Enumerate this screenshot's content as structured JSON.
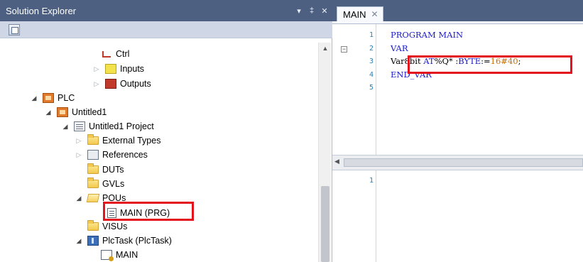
{
  "solution_explorer": {
    "title": "Solution Explorer",
    "title_buttons": [
      "▾",
      "‡",
      "✕"
    ],
    "tree": [
      {
        "label": "Ctrl",
        "icon": "ctrl-icon",
        "expander": ""
      },
      {
        "label": "Inputs",
        "icon": "inputs-icon",
        "expander": "▷"
      },
      {
        "label": "Outputs",
        "icon": "outputs-icon",
        "expander": "▷"
      },
      {
        "label": "PLC",
        "icon": "plc-icon",
        "expander": "◢"
      },
      {
        "label": "Untitled1",
        "icon": "plc-project-icon",
        "expander": "◢"
      },
      {
        "label": "Untitled1 Project",
        "icon": "project-icon",
        "expander": "◢"
      },
      {
        "label": "External Types",
        "icon": "folder-icon",
        "expander": "▷"
      },
      {
        "label": "References",
        "icon": "references-icon",
        "expander": "▷"
      },
      {
        "label": "DUTs",
        "icon": "folder-icon",
        "expander": ""
      },
      {
        "label": "GVLs",
        "icon": "folder-icon",
        "expander": ""
      },
      {
        "label": "POUs",
        "icon": "folder-open-icon",
        "expander": "◢"
      },
      {
        "label": "MAIN (PRG)",
        "icon": "program-icon",
        "expander": ""
      },
      {
        "label": "VISUs",
        "icon": "folder-icon",
        "expander": ""
      },
      {
        "label": "PlcTask (PlcTask)",
        "icon": "task-icon",
        "expander": "◢"
      },
      {
        "label": "MAIN",
        "icon": "program-reference-icon",
        "expander": ""
      }
    ]
  },
  "editor": {
    "tab": {
      "label": "MAIN",
      "close": "✕"
    },
    "declaration_lines": [
      {
        "n": "1",
        "parts": [
          {
            "t": "PROGRAM MAIN",
            "c": "kw"
          }
        ]
      },
      {
        "n": "2",
        "parts": [
          {
            "t": "VAR",
            "c": "kw"
          }
        ]
      },
      {
        "n": "3",
        "parts": [
          {
            "t": "Var8bit ",
            "c": "ident"
          },
          {
            "t": "AT",
            "c": "kw"
          },
          {
            "t": "%Q* :",
            "c": "ident"
          },
          {
            "t": "BYTE",
            "c": "kw"
          },
          {
            "t": ":=",
            "c": "ident"
          },
          {
            "t": "16#40",
            "c": "num"
          },
          {
            "t": ";",
            "c": "ident"
          }
        ]
      },
      {
        "n": "4",
        "parts": [
          {
            "t": "END_VAR",
            "c": "kw"
          }
        ]
      },
      {
        "n": "5",
        "parts": []
      }
    ],
    "implementation_lines": [
      {
        "n": "1",
        "parts": []
      }
    ]
  },
  "colors": {
    "title_bar": "#4d6082",
    "highlight": "#e3121d",
    "keyword": "#1919c8",
    "number": "#c96d00",
    "line_number": "#2b7fb8"
  }
}
